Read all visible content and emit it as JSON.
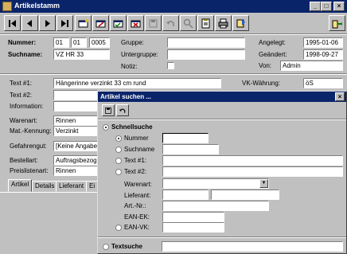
{
  "window": {
    "title": "Artikelstamm"
  },
  "header": {
    "nummer_label": "Nummer:",
    "nummer_part1": "01",
    "nummer_part2": "01",
    "nummer_part3": "0005",
    "suchname_label": "Suchname:",
    "suchname_value": "VZ HR 33",
    "gruppe_label": "Gruppe:",
    "gruppe_value": "",
    "untergruppe_label": "Untergruppe:",
    "untergruppe_value": "",
    "notiz_label": "Notiz:",
    "angelegt_label": "Angelegt:",
    "angelegt_value": "1995-01-06",
    "geaendert_label": "Geändert:",
    "geaendert_value": "1998-09-27",
    "von_label": "Von:",
    "von_value": "Admin"
  },
  "details": {
    "text1_label": "Text #1:",
    "text1_value": "Hängerinne verzinkt 33 cm rund",
    "vk_waehrung_label": "VK-Währung:",
    "vk_waehrung_value": "öS",
    "text2_label": "Text #2:",
    "information_label": "Information:",
    "warenart_label": "Warenart:",
    "warenart_value": "Rinnen",
    "matkennung_label": "Mat.-Kennung:",
    "matkennung_value": "Verzinkt",
    "gefahrengut_label": "Gefahrengut:",
    "gefahrengut_value": "[Keine Angabe]",
    "bestellart_label": "Bestellart:",
    "bestellart_value": "Auftragsbezoge",
    "preislistenart_label": "Preislistenart:",
    "preislistenart_value": "Rinnen"
  },
  "tabs": [
    "Artikel",
    "Details",
    "Lieferant",
    "Ei"
  ],
  "dialog": {
    "title": "Artikel suchen ...",
    "schnellsuche_label": "Schnellsuche",
    "nummer_label": "Nummer",
    "suchname_label": "Suchname",
    "text1_label": "Text #1:",
    "text2_label": "Text #2:",
    "warenart_label": "Warenart:",
    "lieferant_label": "Lieferant:",
    "artnr_label": "Art.-Nr.:",
    "eanek_label": "EAN-EK:",
    "eanvk_label": "EAN-VK:",
    "textsuche_label": "Textsuche"
  },
  "colors": {
    "titlebar": "#0a246a",
    "face": "#c0c0c0"
  }
}
